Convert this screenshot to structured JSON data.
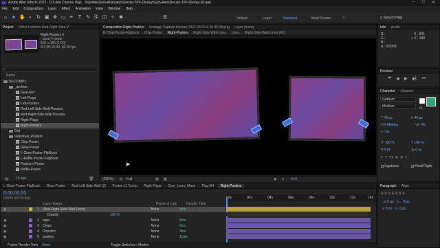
{
  "titlebar": {
    "title": "Adobe After Effects 2022 - D:\\Little Cinema Digit... Bulk\\AE\\Gym-Animated-Decals-TPF-Disney\\Gym-AnimDecals-TPF-Disney-03.aep",
    "controls": [
      "–",
      "□",
      "✕"
    ]
  },
  "menu": [
    "File",
    "Edit",
    "Composition",
    "Layer",
    "Effect",
    "Animation",
    "View",
    "Window",
    "Help"
  ],
  "toolbar": {
    "workspaces": [
      "Default",
      "Learn",
      "Standard",
      "Small Screen"
    ],
    "active_workspace": "Standard",
    "search_label": "Search Help"
  },
  "project_panel": {
    "tab": "Project",
    "tab2": "Effect Controls Red-Right-Side-V",
    "asset_name": "Right-Posters ▾",
    "asset_info": [
      ", used 4 times",
      "502 x 165 (1.00)",
      "Δ 0;00;15;00, 60.00 fps"
    ],
    "search_placeholder": "",
    "col_name": "Name",
    "items": [
      {
        "name": "00-COMPS",
        "type": "folder",
        "indent": 0
      },
      {
        "name": "_archive",
        "type": "folder",
        "indent": 1
      },
      {
        "name": "Gym-Ref",
        "type": "comp",
        "indent": 2
      },
      {
        "name": "Left-Flags",
        "type": "comp",
        "indent": 2
      },
      {
        "name": "Left-Posters",
        "type": "comp",
        "indent": 2
      },
      {
        "name": "Red-Left-Side-Wall-Preview",
        "type": "comp",
        "indent": 2
      },
      {
        "name": "Red-Right-Side-Wall-Preview",
        "type": "comp",
        "indent": 2
      },
      {
        "name": "Right-Flags",
        "type": "comp",
        "indent": 2
      },
      {
        "name": "Right-Posters",
        "type": "comp",
        "indent": 2,
        "selected": true
      },
      {
        "name": "Out",
        "type": "folder",
        "indent": 1
      },
      {
        "name": "Individual_Posters",
        "type": "folder",
        "indent": 1
      },
      {
        "name": "Chip-Poster",
        "type": "comp",
        "indent": 2
      },
      {
        "name": "Glow-Poster",
        "type": "comp",
        "indent": 2
      },
      {
        "name": "L-Glow-Poster-FlipBook",
        "type": "comp",
        "indent": 2
      },
      {
        "name": "L-Raffle-Poster-FlipBook",
        "type": "comp",
        "indent": 2
      },
      {
        "name": "Popcorn-Poster",
        "type": "comp",
        "indent": 2
      },
      {
        "name": "Raffle-Poster",
        "type": "comp",
        "indent": 2
      }
    ],
    "bpc": "16 bpc"
  },
  "comp_panel": {
    "tab": "Composition Right-Posters",
    "footage_tab": "Footage Capture d'écran 2022-03-03 à 20.39.28.png",
    "layer_tab": "Layer (none)",
    "breadcrumbs": [
      "R-Chip-Poster-Flipbook",
      "Chip-Poster",
      "Right-Posters",
      "Right-Side-Wall-Lines",
      "Lines",
      "Right-Side-Wall-Lines (42)"
    ],
    "active_crumb": "Right-Posters",
    "zoom": "(255%)",
    "resolution": "Full",
    "timecode": "0;00;00;00",
    "exposure": "+0.0"
  },
  "info_panel": {
    "tab": "Info",
    "tab2": "Audio",
    "r": "R :",
    "g": "G :",
    "b": "B :",
    "a": "A : 0.0000",
    "x": "X : 601",
    "y": "+ Y : 189"
  },
  "preview_panel": {
    "tab": "Preview"
  },
  "character_panel": {
    "tab": "Character",
    "tab2": "Libraries",
    "font": "Gotham",
    "style": "Medium",
    "size": "40 px",
    "leading": "44 px",
    "kerning": "Metrics",
    "tracking": "-45",
    "stroke": "- px",
    "scale_v": "100 %",
    "scale_h": "100 %",
    "baseline": "0 px",
    "tsume": "0 %",
    "ligatures": "Ligatures",
    "hindi": "Hindi Digits"
  },
  "paragraph_panel": {
    "tab": "Paragraph",
    "tab2": "Align"
  },
  "timeline": {
    "tabs": [
      "L-Glow-Poster-FlipBook",
      "Glow-Poster",
      "Red-Left-Side-Wall (2)",
      "Poster-L1 Comp",
      "Right-Flags",
      "Gym_Lines_Mask",
      "Flag-R4",
      "Right-Posters"
    ],
    "active_tab": "Right-Posters",
    "timecode": "0;00;00;00",
    "frame_info": "00000 (60.00 fps)",
    "col_layer": "Layer Name",
    "col_parent": "Parent & Link",
    "col_render": "Render Time",
    "ruler": [
      "00s",
      "02s",
      "04s",
      "06s",
      "08s",
      "10s",
      "12s",
      "14s"
    ],
    "layers": [
      {
        "num": "1",
        "name": "[Red-Right-Side-Wall-Lines]",
        "parent": "None",
        "render": "0ms",
        "color": "#c9b24a",
        "selected": true
      },
      {
        "num": "",
        "name": "Opacity",
        "parent": "",
        "render": "",
        "value": "100 %",
        "sub": true
      },
      {
        "num": "2",
        "name": "tape",
        "parent": "None",
        "render": "5ms",
        "color": "#8a62c4"
      },
      {
        "num": "3",
        "name": "Chips",
        "parent": "None",
        "render": "6ms",
        "color": "#8a62c4"
      },
      {
        "num": "4",
        "name": "Popcorn",
        "parent": "None",
        "render": "3ms",
        "color": "#8a62c4"
      },
      {
        "num": "5",
        "name": "posters",
        "parent": "None",
        "render": "11ms",
        "color": "#8a62c4"
      }
    ],
    "none_label": "None",
    "footer_left": "Frame Render Time",
    "footer_time": "34ms",
    "footer_mid": "Toggle Switches / Modes"
  },
  "colors": {
    "accent": "#5b9bff",
    "layer_yellow": "#c9b24a",
    "layer_purple": "#8a62c4",
    "fill_green": "#2fa37a"
  }
}
